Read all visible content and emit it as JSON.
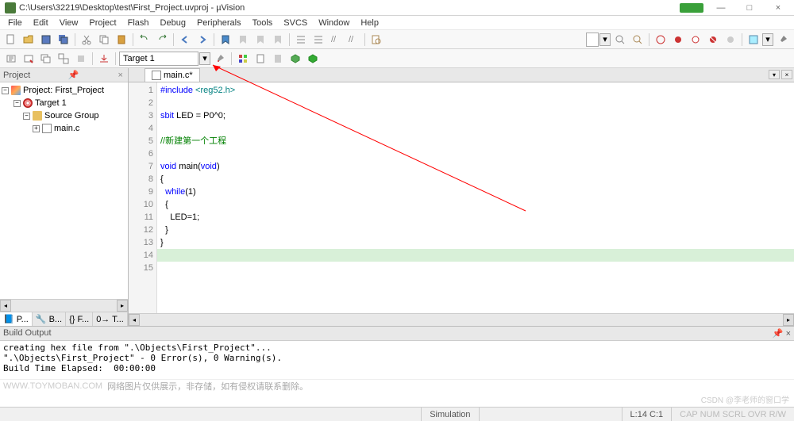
{
  "window": {
    "title": "C:\\Users\\32219\\Desktop\\test\\First_Project.uvproj - µVision",
    "min": "—",
    "max": "□",
    "close": "×"
  },
  "menu": [
    "File",
    "Edit",
    "View",
    "Project",
    "Flash",
    "Debug",
    "Peripherals",
    "Tools",
    "SVCS",
    "Window",
    "Help"
  ],
  "toolbar2": {
    "target_label": "Target 1"
  },
  "project_panel": {
    "title": "Project",
    "root": "Project: First_Project",
    "target": "Target 1",
    "group": "Source Group",
    "file": "main.c",
    "tabs": [
      "📘 P...",
      "🔧 B...",
      "{} F...",
      "0→ T..."
    ]
  },
  "editor": {
    "tab": "main.c*",
    "lines": [
      {
        "n": 1,
        "parts": [
          {
            "t": "#include ",
            "c": "kw-blue"
          },
          {
            "t": "<reg52.h>",
            "c": "str-green"
          }
        ]
      },
      {
        "n": 2,
        "parts": []
      },
      {
        "n": 3,
        "parts": [
          {
            "t": "sbit",
            "c": "kw-blue"
          },
          {
            "t": " LED = P0^0;"
          }
        ]
      },
      {
        "n": 4,
        "parts": []
      },
      {
        "n": 5,
        "parts": [
          {
            "t": "//新建第一个工程",
            "c": "kw-green"
          }
        ]
      },
      {
        "n": 6,
        "parts": []
      },
      {
        "n": 7,
        "parts": [
          {
            "t": "void",
            "c": "kw-blue"
          },
          {
            "t": " main("
          },
          {
            "t": "void",
            "c": "kw-blue"
          },
          {
            "t": ")"
          }
        ]
      },
      {
        "n": 8,
        "parts": [
          {
            "t": "{"
          }
        ]
      },
      {
        "n": 9,
        "parts": [
          {
            "t": "  "
          },
          {
            "t": "while",
            "c": "kw-blue"
          },
          {
            "t": "(1)"
          }
        ]
      },
      {
        "n": 10,
        "parts": [
          {
            "t": "  {"
          }
        ]
      },
      {
        "n": 11,
        "parts": [
          {
            "t": "    LED=1;"
          }
        ]
      },
      {
        "n": 12,
        "parts": [
          {
            "t": "  }"
          }
        ]
      },
      {
        "n": 13,
        "parts": [
          {
            "t": "}"
          }
        ]
      },
      {
        "n": 14,
        "parts": []
      },
      {
        "n": 15,
        "parts": []
      }
    ],
    "highlight_line": 14
  },
  "build_output": {
    "title": "Build Output",
    "text": "creating hex file from \".\\Objects\\First_Project\"...\n\".\\Objects\\First_Project\" - 0 Error(s), 0 Warning(s).\nBuild Time Elapsed:  00:00:00"
  },
  "footer": {
    "watermark": "WWW.TOYMOBAN.COM",
    "caption": "网络图片仅供展示，非存储，如有侵权请联系删除。"
  },
  "status": {
    "mode": "Simulation",
    "pos": "L:14 C:1",
    "flags": "CAP  NUM  SCRL  OVR  R/W",
    "csdn": "CSDN @李老师的窗口学"
  }
}
